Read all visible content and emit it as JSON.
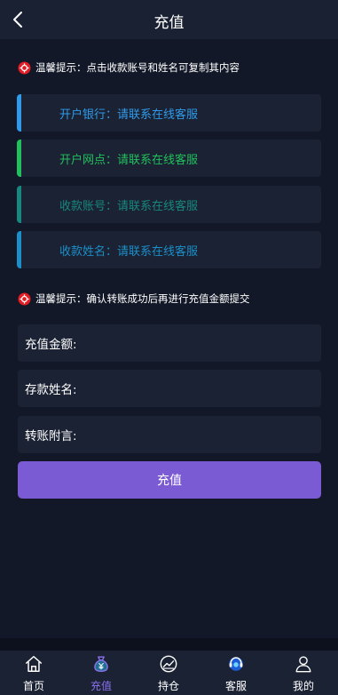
{
  "header": {
    "title": "充值"
  },
  "tips": {
    "tip1": "温馨提示：点击收款账号和姓名可复制其内容",
    "tip2": "温馨提示：确认转账成功后再进行充值金额提交"
  },
  "info_items": [
    {
      "label": "开户银行",
      "value": "请联系在线客服",
      "text": "开户银行：请联系在线客服",
      "color": "#2f9bea"
    },
    {
      "label": "开户网点",
      "value": "请联系在线客服",
      "text": "开户网点：请联系在线客服",
      "color": "#20c05c"
    },
    {
      "label": "收款账号",
      "value": "请联系在线客服",
      "text": "收款账号：请联系在线客服",
      "color": "#17887f"
    },
    {
      "label": "收款姓名",
      "value": "请联系在线客服",
      "text": "收款姓名：请联系在线客服",
      "color": "#1b8fc9"
    }
  ],
  "form": {
    "amount_label": "充值金额:",
    "amount_value": "",
    "name_label": "存款姓名:",
    "name_value": "",
    "note_label": "转账附言:",
    "note_value": "",
    "submit_label": "充值"
  },
  "tabbar": {
    "items": [
      {
        "label": "首页",
        "icon": "home-icon"
      },
      {
        "label": "充值",
        "icon": "money-bag-icon",
        "active": true
      },
      {
        "label": "持仓",
        "icon": "chart-icon"
      },
      {
        "label": "客服",
        "icon": "customer-service-icon"
      },
      {
        "label": "我的",
        "icon": "user-icon"
      }
    ]
  },
  "colors": {
    "background": "#121827",
    "card": "#1b2233",
    "accent": "#7b5bd3",
    "active_tab": "#8c72ee",
    "tip_icon": "#e31b23"
  }
}
